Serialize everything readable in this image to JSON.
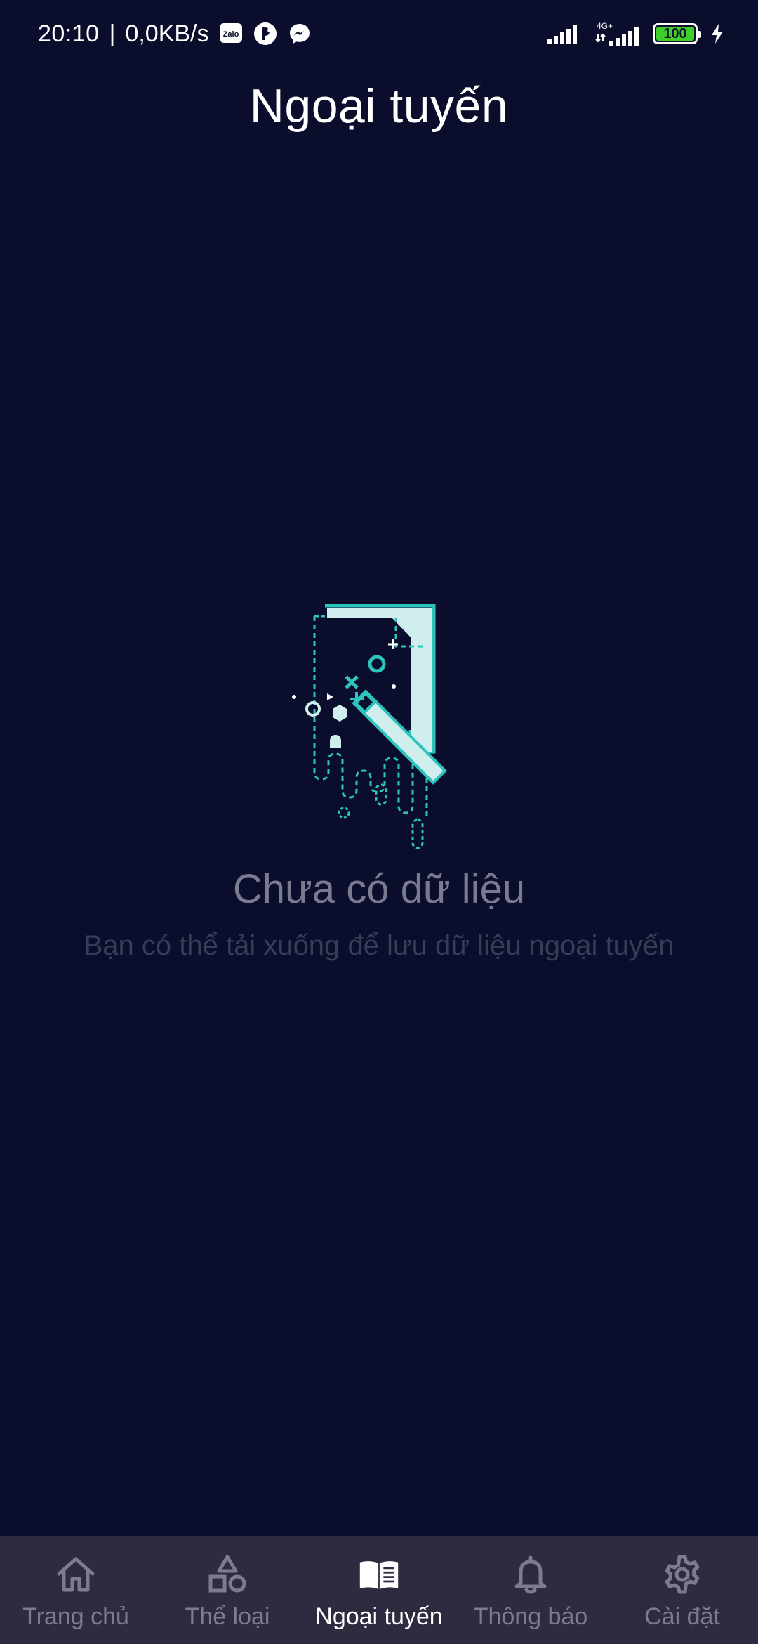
{
  "status_bar": {
    "time": "20:10",
    "separator": "|",
    "network_speed": "0,0KB/s",
    "left_icons": [
      "zalo-icon",
      "notification-app-icon",
      "messenger-icon"
    ],
    "zalo_text": "Zalo",
    "network_type": "4G+",
    "battery_level": "100",
    "battery_color": "#3fcf2a"
  },
  "header": {
    "title": "Ngoại tuyến"
  },
  "empty_state": {
    "title": "Chưa có dữ liệu",
    "subtitle": "Bạn có thể tải xuống để lưu dữ liệu ngoại tuyến",
    "accent_color": "#2cc4bd",
    "illustration": "magic-wand-document-icon"
  },
  "bottom_nav": {
    "active_index": 2,
    "active_color": "#ffffff",
    "inactive_color": "#7d7b8e",
    "background": "#2d2b40",
    "items": [
      {
        "label": "Trang chủ",
        "icon": "home-icon"
      },
      {
        "label": "Thể loại",
        "icon": "categories-icon"
      },
      {
        "label": "Ngoại tuyến",
        "icon": "book-icon"
      },
      {
        "label": "Thông báo",
        "icon": "bell-icon"
      },
      {
        "label": "Cài đặt",
        "icon": "gear-icon"
      }
    ]
  }
}
